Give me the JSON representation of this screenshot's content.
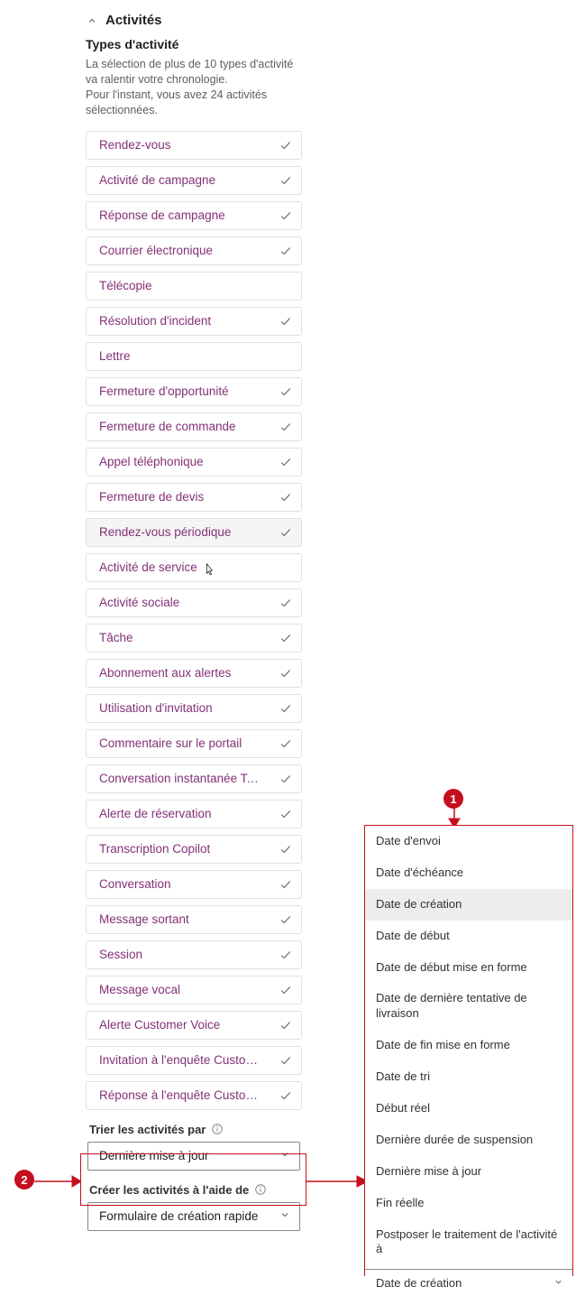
{
  "section": {
    "title": "Activités",
    "subtitle": "Types d'activité",
    "helper": "La sélection de plus de 10 types d'activité va ralentir votre chronologie.\nPour l'instant, vous avez 24 activités sélectionnées."
  },
  "activities": [
    {
      "label": "Rendez-vous",
      "checked": true
    },
    {
      "label": "Activité de campagne",
      "checked": true
    },
    {
      "label": "Réponse de campagne",
      "checked": true
    },
    {
      "label": "Courrier électronique",
      "checked": true
    },
    {
      "label": "Télécopie",
      "checked": false
    },
    {
      "label": "Résolution d'incident",
      "checked": true
    },
    {
      "label": "Lettre",
      "checked": false
    },
    {
      "label": "Fermeture d'opportunité",
      "checked": true
    },
    {
      "label": "Fermeture de commande",
      "checked": true
    },
    {
      "label": "Appel téléphonique",
      "checked": true
    },
    {
      "label": "Fermeture de devis",
      "checked": true
    },
    {
      "label": "Rendez-vous périodique",
      "checked": true,
      "hovered": true
    },
    {
      "label": "Activité de service",
      "checked": false
    },
    {
      "label": "Activité sociale",
      "checked": true
    },
    {
      "label": "Tâche",
      "checked": true
    },
    {
      "label": "Abonnement aux alertes",
      "checked": true
    },
    {
      "label": "Utilisation d'invitation",
      "checked": true
    },
    {
      "label": "Commentaire sur le portail",
      "checked": true
    },
    {
      "label": "Conversation instantanée Teams",
      "checked": true
    },
    {
      "label": "Alerte de réservation",
      "checked": true
    },
    {
      "label": "Transcription Copilot",
      "checked": true
    },
    {
      "label": "Conversation",
      "checked": true
    },
    {
      "label": "Message sortant",
      "checked": true
    },
    {
      "label": "Session",
      "checked": true
    },
    {
      "label": "Message vocal",
      "checked": true
    },
    {
      "label": "Alerte Customer Voice",
      "checked": true
    },
    {
      "label": "Invitation à l'enquête Customer Voice",
      "checked": true
    },
    {
      "label": "Réponse à l'enquête Customer Voice",
      "checked": true
    }
  ],
  "sort": {
    "label": "Trier les activités par",
    "value": "Dernière mise à jour"
  },
  "create": {
    "label": "Créer les activités à l'aide de",
    "value": "Formulaire de création rapide"
  },
  "dropdown": {
    "options": [
      {
        "label": "Date d'envoi"
      },
      {
        "label": "Date d'échéance"
      },
      {
        "label": "Date de création",
        "selected": true
      },
      {
        "label": "Date de début"
      },
      {
        "label": "Date de début mise en forme"
      },
      {
        "label": "Date de dernière tentative de livraison"
      },
      {
        "label": "Date de fin mise en forme"
      },
      {
        "label": "Date de tri"
      },
      {
        "label": "Début réel"
      },
      {
        "label": "Dernière durée de suspension"
      },
      {
        "label": "Dernière mise à jour"
      },
      {
        "label": "Fin réelle"
      },
      {
        "label": "Postposer le traitement de l'activité à"
      }
    ],
    "result": "Date de création"
  },
  "markers": {
    "one": "1",
    "two": "2"
  }
}
